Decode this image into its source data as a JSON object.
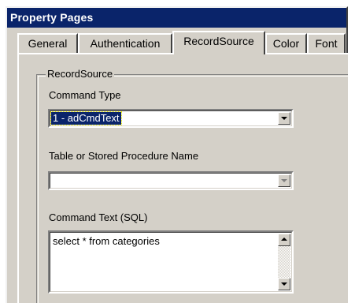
{
  "window": {
    "title": "Property Pages"
  },
  "tabs": [
    {
      "label": "General",
      "active": false
    },
    {
      "label": "Authentication",
      "active": false
    },
    {
      "label": "RecordSource",
      "active": true
    },
    {
      "label": "Color",
      "active": false
    },
    {
      "label": "Font",
      "active": false
    }
  ],
  "recordsource": {
    "group_label": "RecordSource",
    "command_type_label": "Command Type",
    "command_type_value": "1 - adCmdText",
    "table_label": "Table or Stored Procedure Name",
    "table_value": "",
    "command_text_label": "Command Text (SQL)",
    "command_text_value": "select * from categories"
  },
  "colors": {
    "titlebar": "#0a246a",
    "face": "#d4d0c8",
    "selection": "#0a246a"
  }
}
